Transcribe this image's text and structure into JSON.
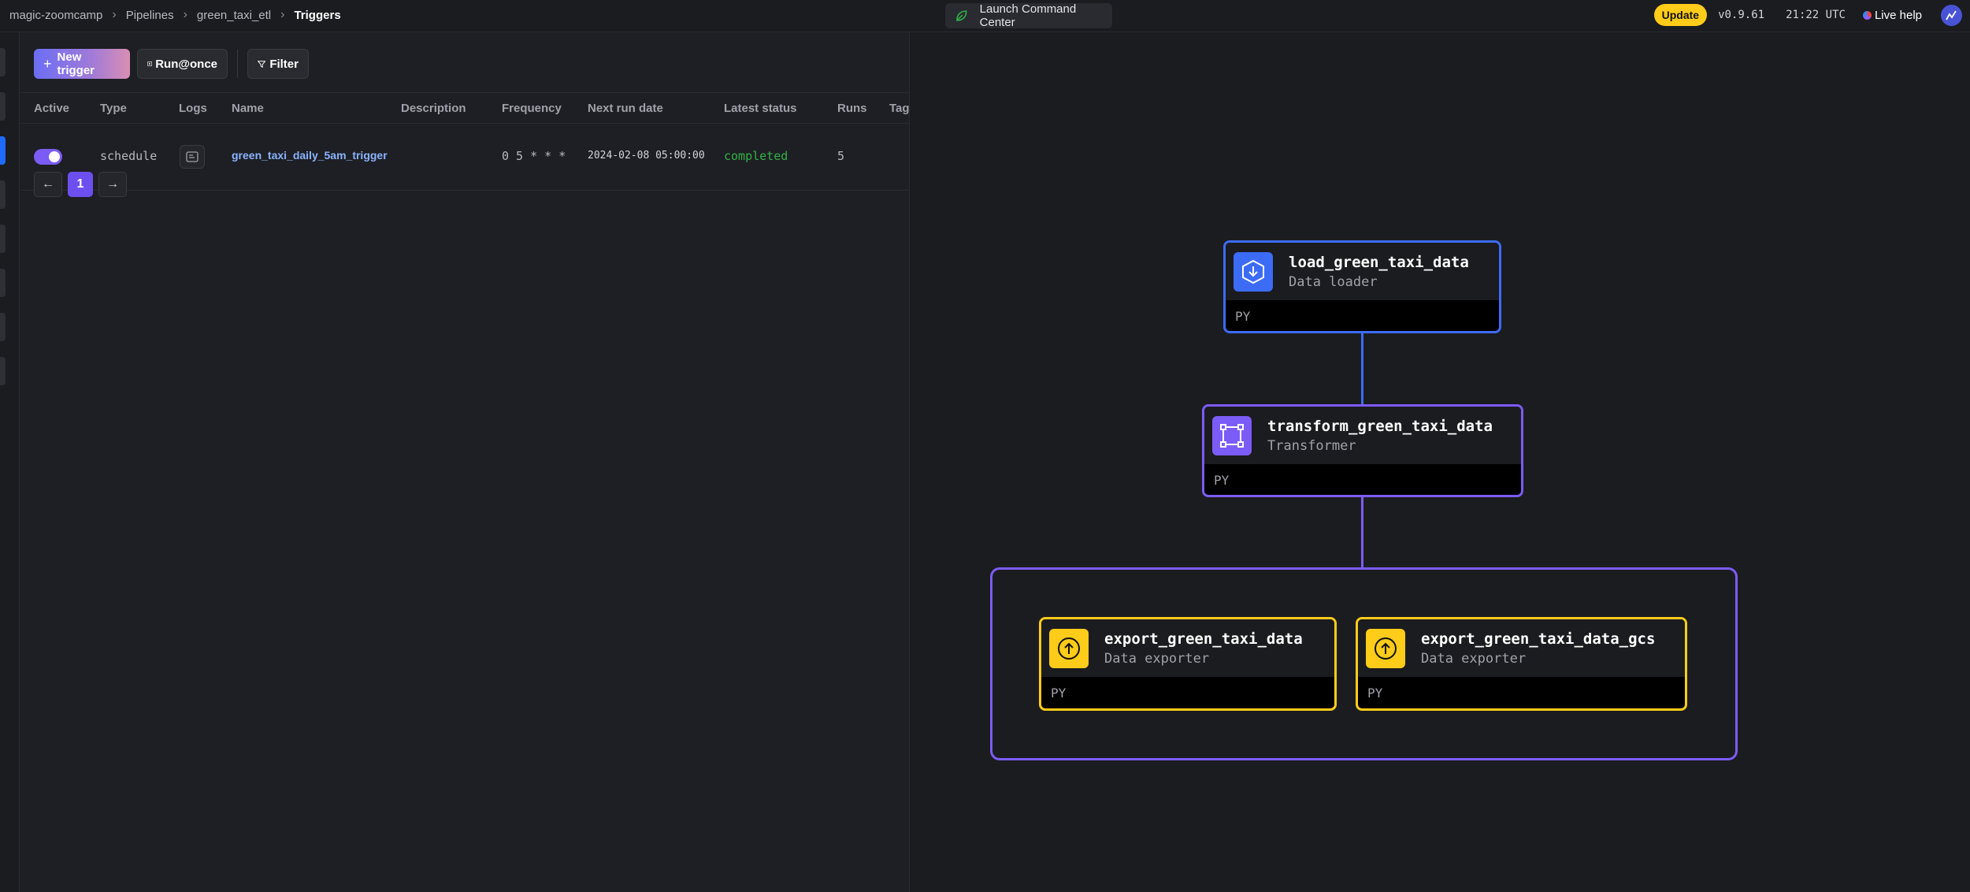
{
  "header": {
    "breadcrumbs": [
      "magic-zoomcamp",
      "Pipelines",
      "green_taxi_etl"
    ],
    "current": "Triggers",
    "command_center_label": "Launch Command Center",
    "update_label": "Update",
    "version": "v0.9.61",
    "time": "21:22 UTC",
    "live_help_label": "Live help"
  },
  "toolbar": {
    "new_trigger_label": "New trigger",
    "run_once_label": "Run@once",
    "filter_label": "Filter"
  },
  "table": {
    "columns": [
      "Active",
      "Type",
      "Logs",
      "Name",
      "Description",
      "Frequency",
      "Next run date",
      "Latest status",
      "Runs",
      "Tag"
    ],
    "rows": [
      {
        "active": true,
        "type": "schedule",
        "name": "green_taxi_daily_5am_trigger",
        "description": "",
        "frequency": "0 5 * * *",
        "next_run_date": "2024-02-08 05:00:00",
        "latest_status": "completed",
        "runs": "5"
      }
    ]
  },
  "pagination": {
    "prev_icon": "arrow-left-icon",
    "current_page": "1",
    "next_icon": "arrow-right-icon"
  },
  "blocks": [
    {
      "name": "load_green_taxi_data",
      "type": "Data loader",
      "language": "PY",
      "color": "#3c6cf6",
      "icon": "download-icon"
    },
    {
      "name": "transform_green_taxi_data",
      "type": "Transformer",
      "language": "PY",
      "color": "#7c5cf6",
      "icon": "transform-icon"
    },
    {
      "name": "export_green_taxi_data",
      "type": "Data exporter",
      "language": "PY",
      "color": "#ffcc19",
      "icon": "upload-icon"
    },
    {
      "name": "export_green_taxi_data_gcs",
      "type": "Data exporter",
      "language": "PY",
      "color": "#ffcc19",
      "icon": "upload-icon"
    }
  ],
  "colors": {
    "loader": "#3c6cf6",
    "transformer": "#7c5cf6",
    "exporter": "#ffcc19",
    "status_completed": "#2fb344",
    "accent": "#1f6bff"
  }
}
